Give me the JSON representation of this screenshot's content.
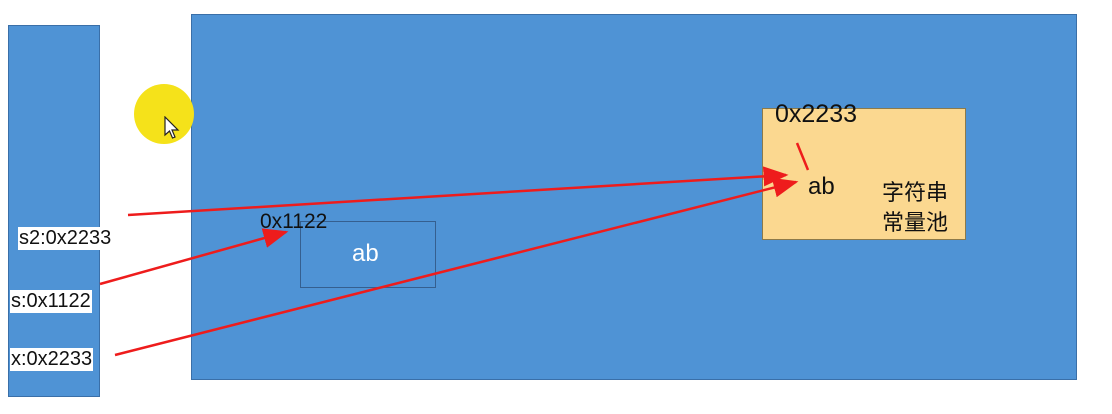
{
  "stack": {
    "vars": [
      {
        "id": "s2",
        "label": "s2:0x2233"
      },
      {
        "id": "s",
        "label": "s:0x1122"
      },
      {
        "id": "x",
        "label": "x:0x2233"
      }
    ]
  },
  "heap": {
    "object": {
      "address": "0x1122",
      "value": "ab"
    },
    "pool": {
      "address": "0x2233",
      "value": "ab",
      "label_line1": "字符串",
      "label_line2": "常量池"
    }
  },
  "colors": {
    "memory_block": "#4f93d5",
    "pool_fill": "#fbd890",
    "arrow": "#ee1c1c",
    "cursor_highlight": "#f5e21a"
  },
  "icons": [
    "mouse-pointer-icon"
  ]
}
